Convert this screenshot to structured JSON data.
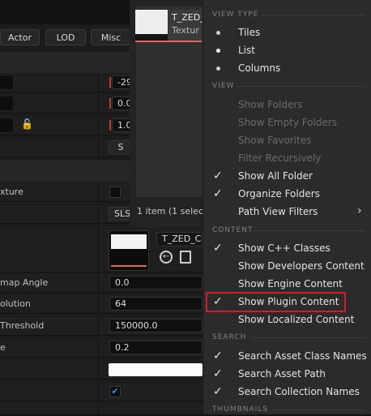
{
  "details": {
    "tabs": [
      "Actor",
      "LOD",
      "Misc"
    ],
    "rows": [
      {
        "label": "",
        "value": "-29"
      },
      {
        "label": "",
        "value": "0.0"
      },
      {
        "label": "",
        "value": "1.0"
      },
      {
        "label": "",
        "value": "S"
      },
      {
        "label": "xture",
        "value": ""
      },
      {
        "label": "",
        "value": "SLS"
      },
      {
        "label": "map Angle",
        "value": "0.0"
      },
      {
        "label": "olution",
        "value": "64"
      },
      {
        "label": "Threshold",
        "value": "150000.0"
      },
      {
        "label": "e",
        "value": "0.2"
      }
    ],
    "texture_name": "T_ZED_Cu"
  },
  "picker": {
    "tile_name_line1": "T_ZED_",
    "tile_name_line2": "Textur",
    "status": "1 item (1 selec"
  },
  "menu": {
    "sections": {
      "view_type": "VIEW TYPE",
      "view": "VIEW",
      "content": "CONTENT",
      "search": "SEARCH",
      "thumbnails": "THUMBNAILS"
    },
    "view_type_items": [
      {
        "label": "Tiles",
        "selected": false
      },
      {
        "label": "List",
        "selected": true
      },
      {
        "label": "Columns",
        "selected": false
      }
    ],
    "view_items": [
      {
        "label": "Show Folders",
        "enabled": false,
        "checked": false
      },
      {
        "label": "Show Empty Folders",
        "enabled": false,
        "checked": false
      },
      {
        "label": "Show Favorites",
        "enabled": false,
        "checked": false
      },
      {
        "label": "Filter Recursively",
        "enabled": false,
        "checked": false
      },
      {
        "label": "Show All Folder",
        "enabled": true,
        "checked": true
      },
      {
        "label": "Organize Folders",
        "enabled": true,
        "checked": true
      },
      {
        "label": "Path View Filters",
        "enabled": true,
        "checked": false,
        "submenu": true
      }
    ],
    "content_items": [
      {
        "label": "Show C++ Classes",
        "checked": true
      },
      {
        "label": "Show Developers Content",
        "checked": false
      },
      {
        "label": "Show Engine Content",
        "checked": false
      },
      {
        "label": "Show Plugin Content",
        "checked": true
      },
      {
        "label": "Show Localized Content",
        "checked": false
      }
    ],
    "search_items": [
      {
        "label": "Search Asset Class Names",
        "checked": true
      },
      {
        "label": "Search Asset Path",
        "checked": true
      },
      {
        "label": "Search Collection Names",
        "checked": true
      }
    ]
  }
}
